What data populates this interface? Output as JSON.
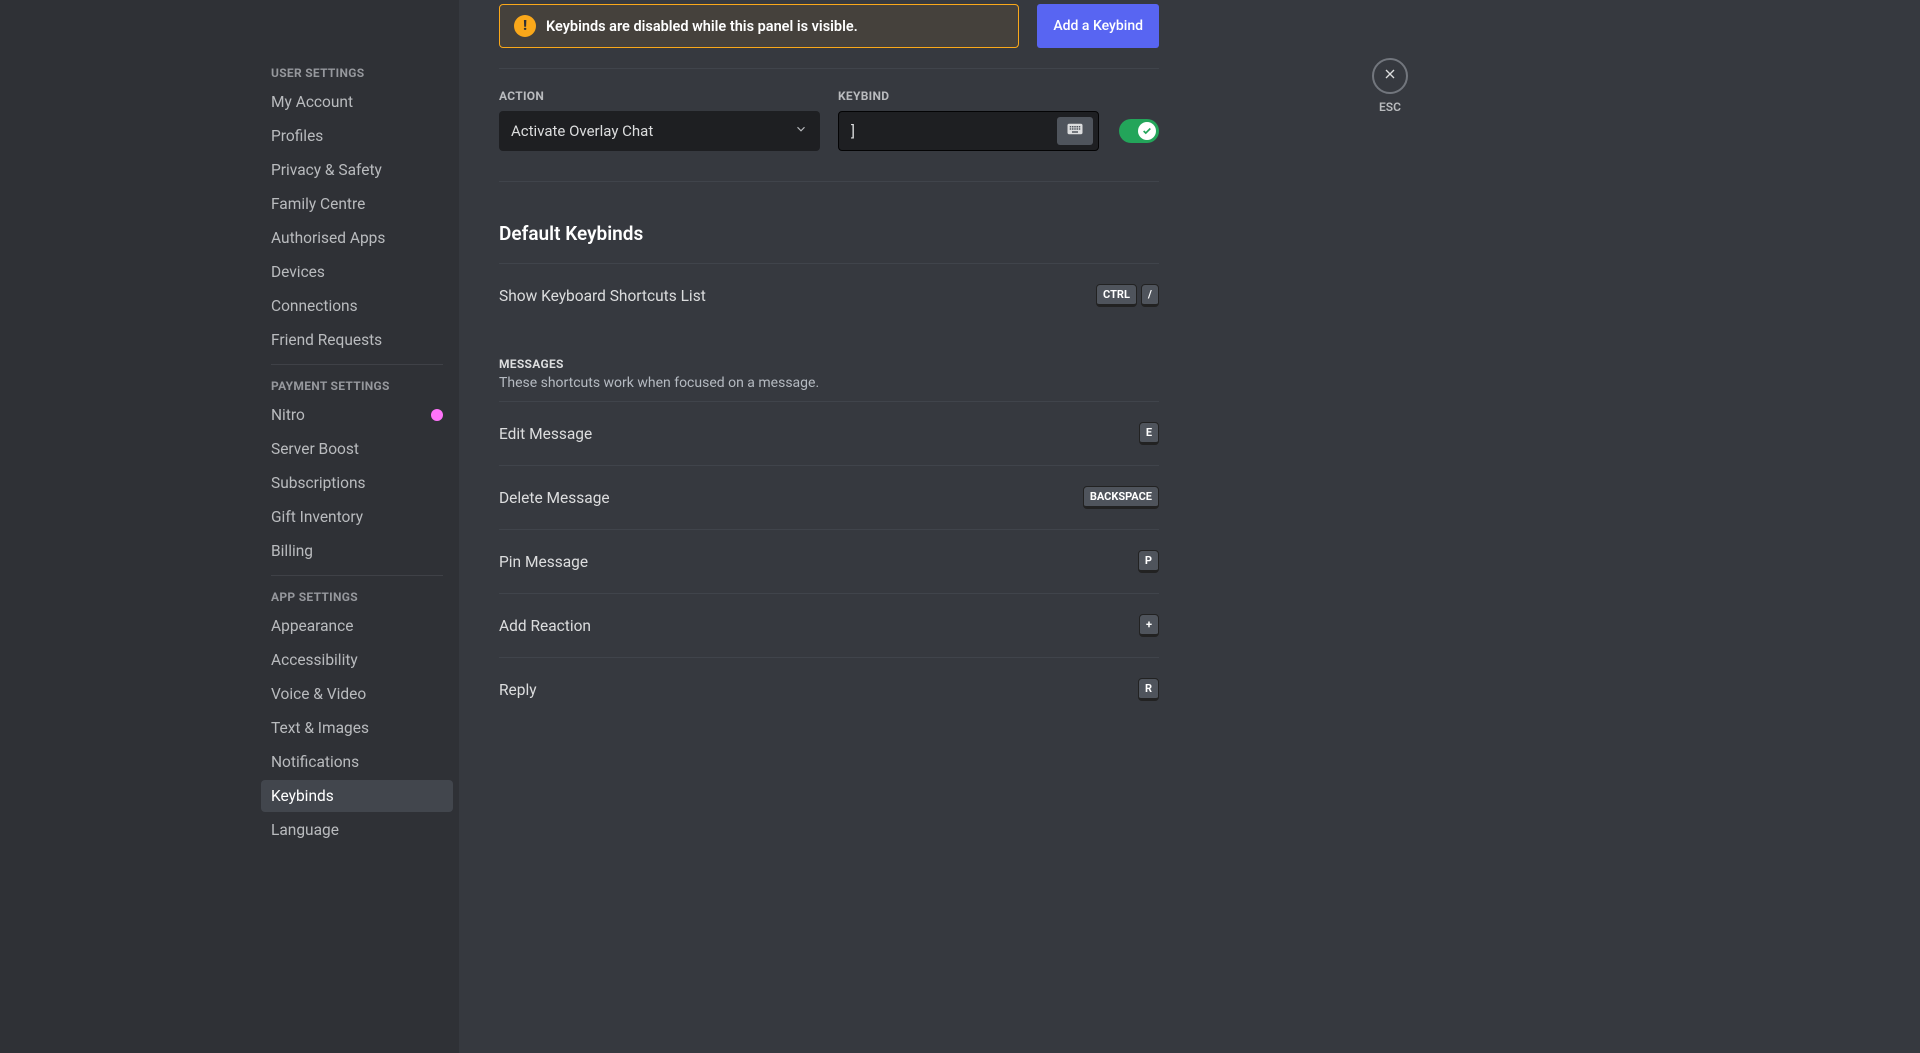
{
  "sidebar": {
    "sections": [
      {
        "header": "User Settings",
        "items": [
          "My Account",
          "Profiles",
          "Privacy & Safety",
          "Family Centre",
          "Authorised Apps",
          "Devices",
          "Connections",
          "Friend Requests"
        ]
      },
      {
        "header": "Payment Settings",
        "items": [
          "Nitro",
          "Server Boost",
          "Subscriptions",
          "Gift Inventory",
          "Billing"
        ]
      },
      {
        "header": "App Settings",
        "items": [
          "Appearance",
          "Accessibility",
          "Voice & Video",
          "Text & Images",
          "Notifications",
          "Keybinds",
          "Language"
        ]
      }
    ],
    "selected": "Keybinds"
  },
  "warning": {
    "text": "Keybinds are disabled while this panel is visible."
  },
  "add_button": "Add a Keybind",
  "fields": {
    "action_label": "Action",
    "action_value": "Activate Overlay Chat",
    "keybind_label": "Keybind",
    "keybind_value": "]"
  },
  "default_title": "Default Keybinds",
  "top_shortcut": {
    "label": "Show Keyboard Shortcuts List",
    "keys": [
      "CTRL",
      "/"
    ]
  },
  "messages_section": {
    "title": "Messages",
    "desc": "These shortcuts work when focused on a message.",
    "items": [
      {
        "label": "Edit Message",
        "keys": [
          "E"
        ]
      },
      {
        "label": "Delete Message",
        "keys": [
          "BACKSPACE"
        ]
      },
      {
        "label": "Pin Message",
        "keys": [
          "P"
        ]
      },
      {
        "label": "Add Reaction",
        "keys": [
          "+"
        ]
      },
      {
        "label": "Reply",
        "keys": [
          "R"
        ]
      }
    ]
  },
  "close_label": "ESC"
}
